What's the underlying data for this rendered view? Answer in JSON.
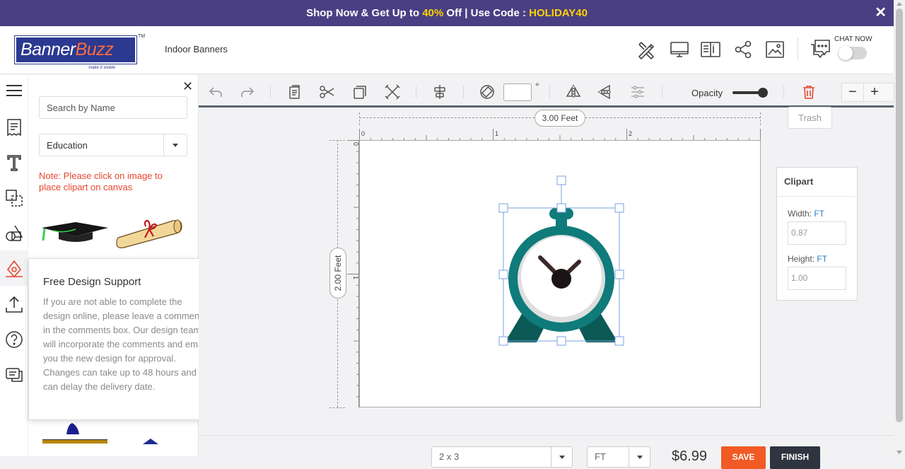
{
  "promo": {
    "prefix": "Shop Now & Get Up to ",
    "discount": "40%",
    "middle": " Off | Use Code : ",
    "code": "HOLIDAY40",
    "close": "✕"
  },
  "header": {
    "logo_banner": "Banner",
    "logo_buzz": "Buzz",
    "logo_tagline": "make it visible",
    "trademark": "TM",
    "breadcrumb": "Indoor Banners",
    "chat_label": "CHAT NOW"
  },
  "panel": {
    "close": "✕",
    "search_placeholder": "Search by Name",
    "category": "Education",
    "note": "Note: Please click on image to place clipart on canvas"
  },
  "popup": {
    "close": "✕",
    "title": "Free Design Support",
    "body": "If you are not able to complete the design online, please leave a comments in the comments box. Our design team will incorporate the comments and email you the new design for approval. Changes can take up to 48 hours and can delay the delivery date."
  },
  "toolbar": {
    "degree": "°",
    "opacity_label": "Opacity",
    "opacity_value": 0.85,
    "zoom_out": "−",
    "zoom_in": "+",
    "trash_tooltip": "Trash"
  },
  "canvas": {
    "width_label": "3.00 Feet",
    "height_label": "2.00 Feet",
    "ruler_top": [
      "0",
      "1",
      "2"
    ],
    "ruler_left": [
      "0",
      "1"
    ]
  },
  "clipart_panel": {
    "title": "Clipart",
    "width_label": "Width:",
    "height_label": "Height:",
    "unit": "FT",
    "width_value": "0.87",
    "height_value": "1.00"
  },
  "footer": {
    "select1": "2 x 3",
    "select2": "FT",
    "price": "$6.99",
    "save": "SAVE",
    "finish": "FINISH"
  },
  "colors": {
    "promo_bg": "#4a3f83",
    "promo_highlight": "#ffd200",
    "accent_orange": "#f15a24",
    "brand_blue": "#2b3990",
    "clock_teal": "#0f7b7a"
  }
}
